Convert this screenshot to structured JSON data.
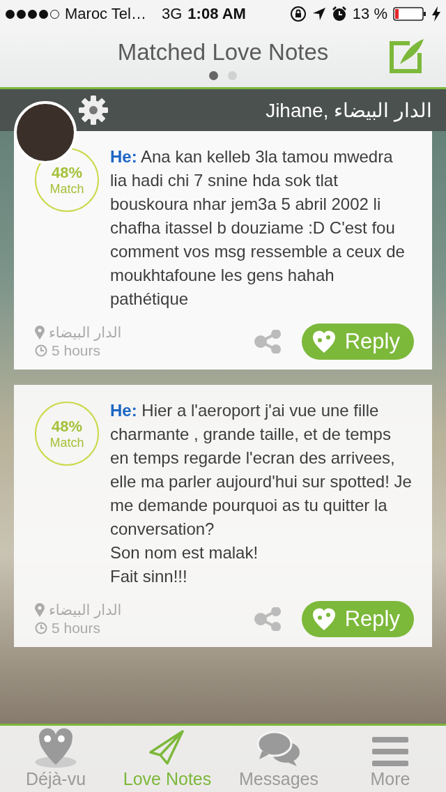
{
  "status_bar": {
    "carrier": "Maroc Tel…",
    "network": "3G",
    "time": "1:08 AM",
    "battery_text": "13 %"
  },
  "header": {
    "title": "Matched Love Notes",
    "page_dots": [
      {
        "selected": true
      },
      {
        "selected": false
      }
    ]
  },
  "profile": {
    "name": "Jihane, الدار البيضاء"
  },
  "notes": [
    {
      "match_percent": "48%",
      "match_label": "Match",
      "message": "**He:** Ana kan kelleb 3la tamou mwedra lia hadi chi 7 snine hda sok tlat bouskoura nhar jem3a 5 abril 2002 li chafha itassel b douziame :D C'est fou comment vos msg ressemble a ceux de moukhtafoune les gens hahah pathétique",
      "location": "الدار البيضاء",
      "time": "5 hours",
      "reply": "Reply"
    },
    {
      "match_percent": "48%",
      "match_label": "Match",
      "message": "**He:** Hier a l'aeroport j'ai vue une fille charmante , grande taille, et de temps en temps regarde l'ecran des arrivees, elle ma parler aujourd'hui sur spotted! Je me demande pourquoi as tu quitter la conversation?\nSon nom est malak!\nFait sinn!!!",
      "location": "الدار البيضاء",
      "time": "5 hours",
      "reply": "Reply"
    }
  ],
  "tabs": [
    {
      "label": "Déjà-vu",
      "selected": false
    },
    {
      "label": "Love Notes",
      "selected": true
    },
    {
      "label": "Messages",
      "selected": false
    },
    {
      "label": "More",
      "selected": false
    }
  ]
}
